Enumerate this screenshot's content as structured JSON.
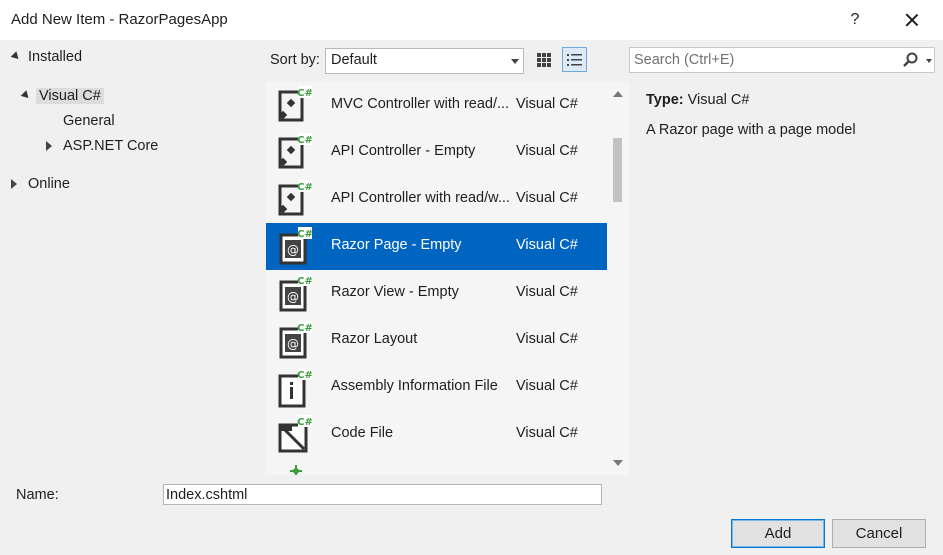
{
  "window": {
    "title": "Add New Item - RazorPagesApp",
    "help_label": "?"
  },
  "tree": {
    "installed": "Installed",
    "visual_csharp": "Visual C#",
    "general": "General",
    "aspnet_core": "ASP.NET Core",
    "online": "Online"
  },
  "sort": {
    "label": "Sort by:",
    "value": "Default"
  },
  "templates": [
    {
      "name": "MVC Controller with read/...",
      "lang": "Visual C#",
      "icon": "controller-icon"
    },
    {
      "name": "API Controller - Empty",
      "lang": "Visual C#",
      "icon": "controller-icon"
    },
    {
      "name": "API Controller with read/w...",
      "lang": "Visual C#",
      "icon": "controller-icon"
    },
    {
      "name": "Razor Page - Empty",
      "lang": "Visual C#",
      "icon": "razor-icon",
      "selected": true
    },
    {
      "name": "Razor View - Empty",
      "lang": "Visual C#",
      "icon": "razor-icon"
    },
    {
      "name": "Razor Layout",
      "lang": "Visual C#",
      "icon": "razor-icon"
    },
    {
      "name": "Assembly Information File",
      "lang": "Visual C#",
      "icon": "info-file-icon"
    },
    {
      "name": "Code File",
      "lang": "Visual C#",
      "icon": "code-file-icon"
    }
  ],
  "search": {
    "placeholder": "Search (Ctrl+E)",
    "value": ""
  },
  "detail": {
    "type_label": "Type:",
    "type_value": "Visual C#",
    "description": "A Razor page with a page model"
  },
  "name_field": {
    "label": "Name:",
    "value": "Index.cshtml"
  },
  "buttons": {
    "add": "Add",
    "cancel": "Cancel"
  },
  "colors": {
    "selection": "#0064c1",
    "csharp_badge": "#3c9c3c"
  }
}
